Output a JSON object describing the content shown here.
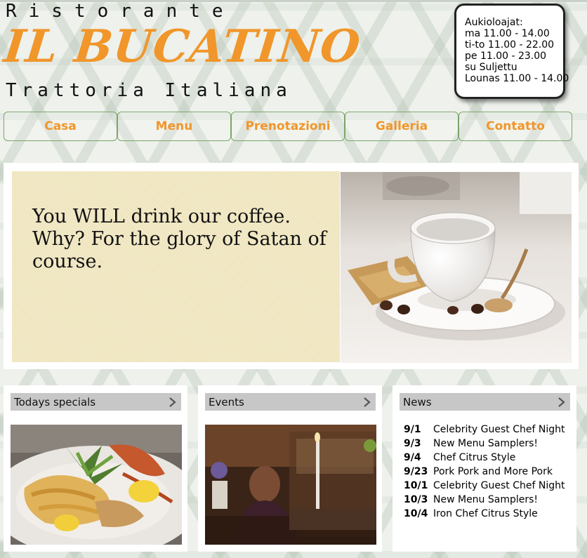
{
  "brand": {
    "line1": "Ristorante",
    "name": "IL BUCATINO",
    "line2": "Trattoria Italiana"
  },
  "hours": {
    "title": "Aukioloajat:",
    "lines": [
      "ma 11.00 - 14.00",
      "ti-to 11.00 - 22.00",
      "pe 11.00 - 23.00",
      "su Suljettu",
      "Lounas 11.00 - 14.00"
    ]
  },
  "nav": {
    "items": [
      {
        "label": "Casa"
      },
      {
        "label": "Menu"
      },
      {
        "label": "Prenotazioni"
      },
      {
        "label": "Galleria"
      },
      {
        "label": "Contatto"
      }
    ]
  },
  "hero": {
    "quote": "You WILL drink our coffee. Why? For the glory of Satan of course."
  },
  "cards": {
    "specials": {
      "title": "Todays specials"
    },
    "events": {
      "title": "Events"
    },
    "news": {
      "title": "News",
      "items": [
        {
          "date": "9/1",
          "title": "Celebrity Guest Chef Night"
        },
        {
          "date": "9/3",
          "title": "New Menu Samplers!"
        },
        {
          "date": "9/4",
          "title": "Chef Citrus Style"
        },
        {
          "date": "9/23",
          "title": "Pork Pork and More Pork"
        },
        {
          "date": "10/1",
          "title": "Celebrity Guest Chef Night"
        },
        {
          "date": "10/3",
          "title": "New Menu Samplers!"
        },
        {
          "date": "10/4",
          "title": "Iron Chef Citrus Style"
        }
      ]
    }
  },
  "colors": {
    "accent": "#f1962a",
    "nav_border": "#7aa56a",
    "hero_panel": "#efe5bf",
    "card_header": "#c7c7c7"
  }
}
